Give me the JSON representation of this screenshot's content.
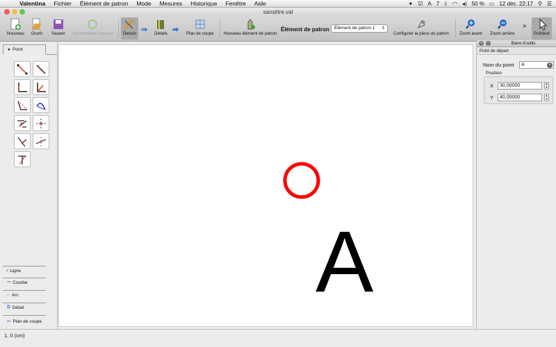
{
  "menubar": {
    "app": "Valentina",
    "items": [
      "Fichier",
      "Élément de patron",
      "Mode",
      "Mesures",
      "Historique",
      "Fenêtre",
      "Aide"
    ],
    "status": {
      "badge": "7",
      "battery": "50 %",
      "datetime": "12 déc. 22:17"
    }
  },
  "window": {
    "title": "sanstitre.val"
  },
  "toolbar": {
    "new": "Nouveau",
    "open": "Ouvrir",
    "save": "Sauver",
    "sync": "Synchroniser mesure",
    "draw": "Dessin",
    "details": "Détails",
    "layout": "Plan de coupe",
    "new_piece": "Nouveau élément de patron",
    "piece_label": "Élément de patron :",
    "piece_value": "Élément de patron 1",
    "configure": "Configurer la pièce du patron",
    "zoom_in": "Zoom avant",
    "zoom_out": "Zoom arrière",
    "more": "»",
    "pointer": "Pointeur"
  },
  "left": {
    "tab_point": "Point",
    "tabs": [
      "Ligne",
      "Courbe",
      "Arc",
      "Détail",
      "Plan de coupe"
    ]
  },
  "canvas": {
    "point_label": "A",
    "point_color": "#ff0000"
  },
  "right": {
    "header": "Barre d'outils",
    "section": "Point de départ",
    "name_label": "Nom du point",
    "name_value": "A",
    "position_label": "Position",
    "x_label": "X",
    "x_value": "30,00000",
    "y_label": "Y",
    "y_value": "40,00000"
  },
  "status": {
    "coords": "1, 0 (cm)"
  }
}
